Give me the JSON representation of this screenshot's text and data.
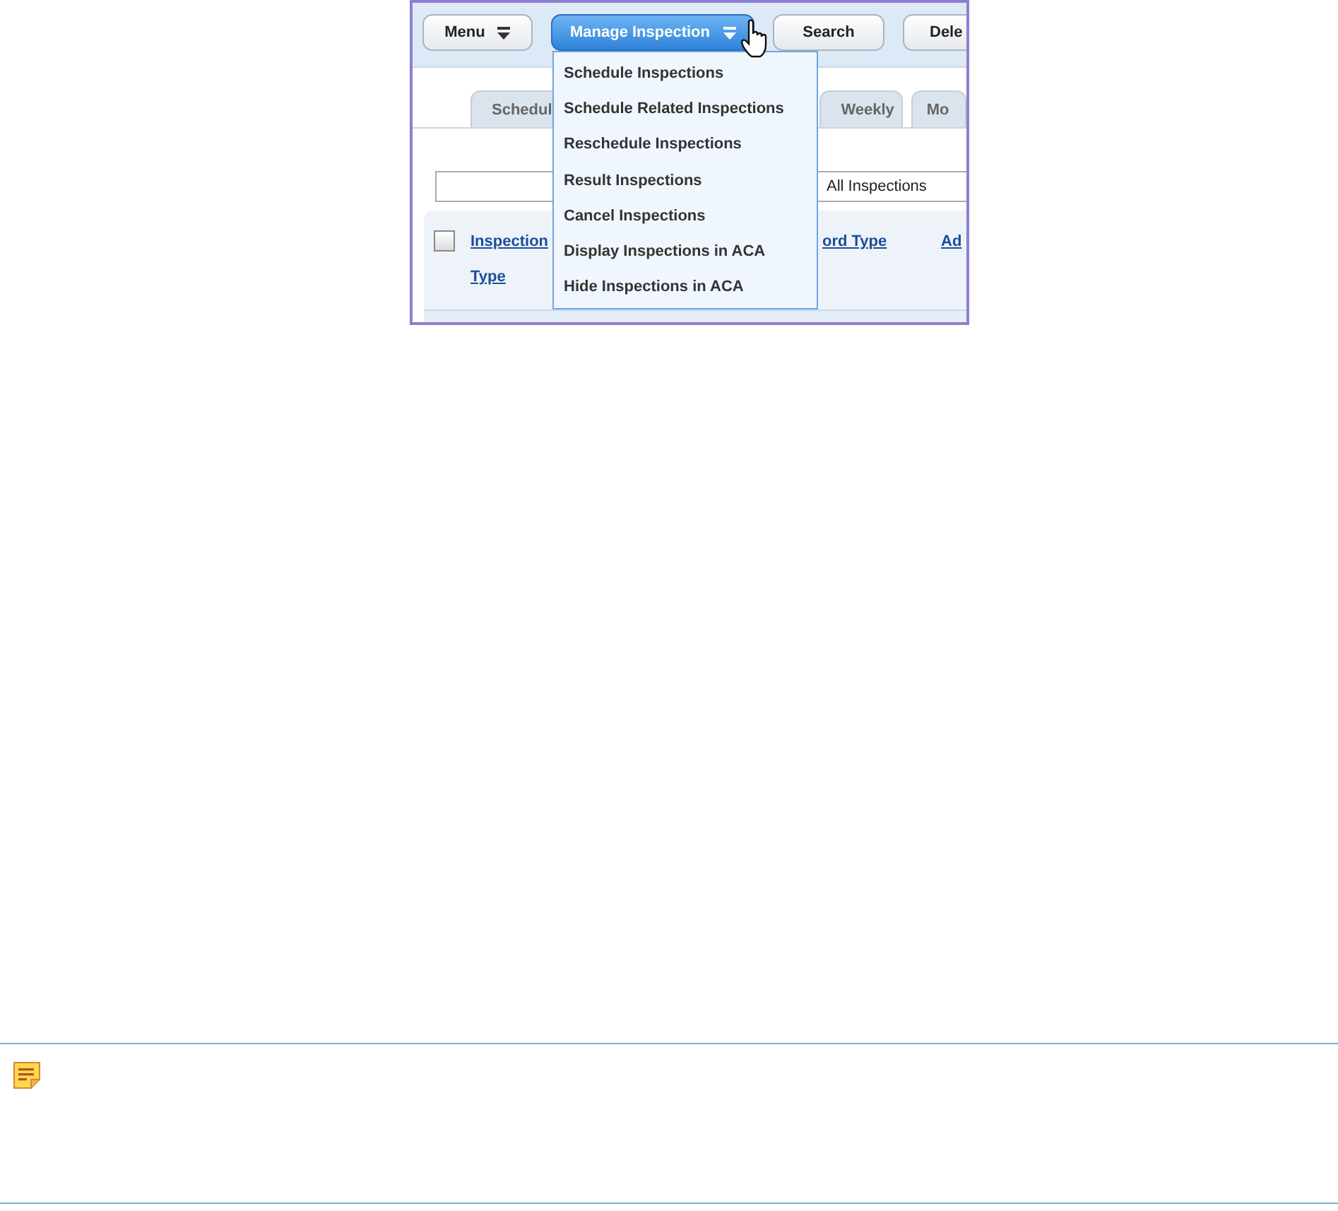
{
  "screenshot": {
    "toolbar": [
      {
        "label": "Menu",
        "has_menu": true,
        "selected": false
      },
      {
        "label": "Manage Inspection",
        "has_menu": true,
        "selected": true
      },
      {
        "label": "Search",
        "has_menu": false,
        "selected": false
      },
      {
        "label": "Dele",
        "has_menu": false,
        "selected": false
      }
    ],
    "menu_items": [
      "Schedule Inspections",
      "Schedule Related Inspections",
      "Reschedule Inspections",
      "Result Inspections",
      "Cancel Inspections",
      "Display Inspections in ACA",
      "Hide Inspections in ACA"
    ],
    "tabs": [
      "Schedul",
      "Weekly",
      "Mo"
    ],
    "filter": {
      "value": "All Inspections"
    },
    "table": {
      "select_all_checked": false,
      "columns": [
        "Inspection Type",
        "ord Type",
        "Ad"
      ]
    }
  },
  "note": {
    "kind": "note"
  }
}
